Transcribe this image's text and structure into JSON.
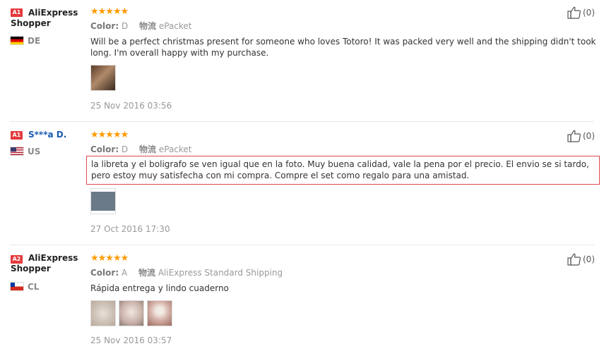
{
  "reviews": [
    {
      "level": "A1",
      "user": "AliExpress Shopper",
      "country_code": "DE",
      "stars": "★★★★★",
      "color_label": "Color:",
      "color_value": "D",
      "shipping_label": "物流",
      "shipping_value": "ePacket",
      "text": "Will be a perfect christmas present for someone who loves Totoro! It was packed very well and the shipping didn't took long. I'm overall happy with my purchase.",
      "date": "25 Nov 2016 03:56",
      "like_count": "(0)"
    },
    {
      "level": "A1",
      "user": "S***a D.",
      "country_code": "US",
      "stars": "★★★★★",
      "color_label": "Color:",
      "color_value": "D",
      "shipping_label": "物流",
      "shipping_value": "ePacket",
      "text": "la libreta y el boligrafo se ven igual que en la foto. Muy buena calidad, vale la pena por el precio. El envio se si tardo, pero estoy muy satisfecha con mi compra. Compre el set como regalo para una amistad.",
      "date": "27 Oct 2016 17:30",
      "like_count": "(0)"
    },
    {
      "level": "A2",
      "user": "AliExpress Shopper",
      "country_code": "CL",
      "stars": "★★★★★",
      "color_label": "Color:",
      "color_value": "A",
      "shipping_label": "物流",
      "shipping_value": "AliExpress Standard Shipping",
      "text": "Rápida entrega y lindo cuaderno",
      "date": "25 Nov 2016 03:57",
      "like_count": "(0)"
    }
  ],
  "colors": {
    "star": "#ff9a00",
    "level_badge": "#e4393c",
    "highlight_border": "#e0474c",
    "username_blue": "#1a59b0"
  },
  "icons": {
    "like": "thumbs-up-icon"
  }
}
